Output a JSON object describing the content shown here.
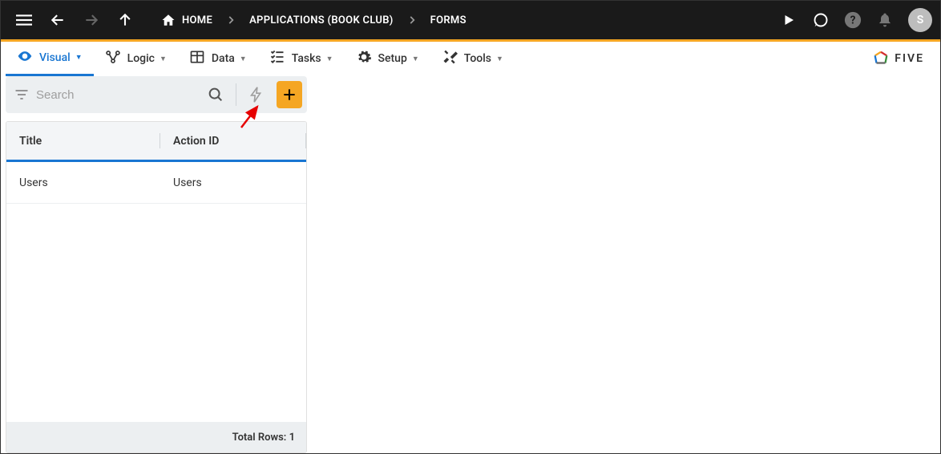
{
  "breadcrumbs": [
    {
      "label": "HOME",
      "home": true
    },
    {
      "label": "APPLICATIONS (BOOK CLUB)"
    },
    {
      "label": "FORMS"
    }
  ],
  "avatar_letter": "S",
  "tabs": [
    {
      "key": "visual",
      "label": "Visual",
      "active": true
    },
    {
      "key": "logic",
      "label": "Logic"
    },
    {
      "key": "data",
      "label": "Data"
    },
    {
      "key": "tasks",
      "label": "Tasks"
    },
    {
      "key": "setup",
      "label": "Setup"
    },
    {
      "key": "tools",
      "label": "Tools"
    }
  ],
  "brand_text": "FIVE",
  "search": {
    "placeholder": "Search",
    "value": ""
  },
  "table": {
    "columns": {
      "title": "Title",
      "action_id": "Action ID"
    },
    "rows": [
      {
        "title": "Users",
        "action_id": "Users"
      }
    ],
    "footer_label": "Total Rows:",
    "footer_count": "1"
  },
  "colors": {
    "accent": "#1976d2",
    "orange": "#f5a623"
  }
}
